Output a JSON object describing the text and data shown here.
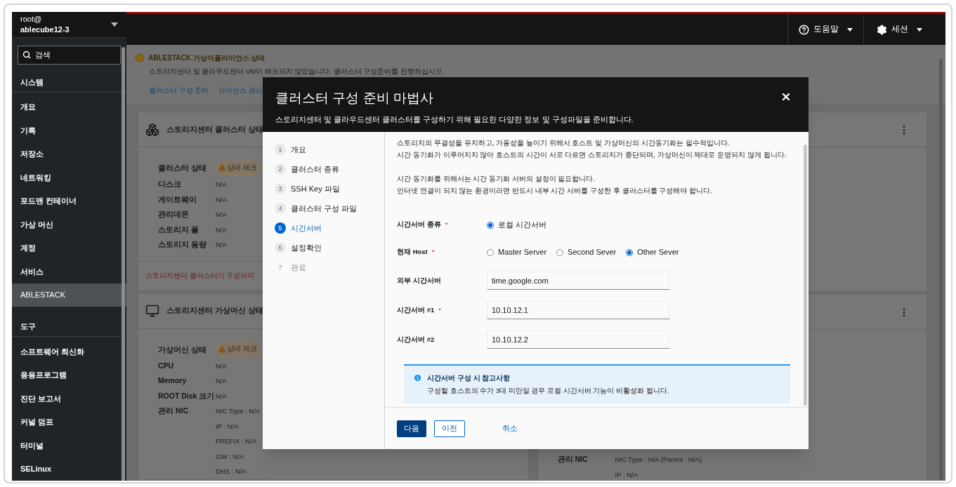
{
  "sidebar": {
    "user": "root@",
    "host": "ablecube12-3",
    "search": {
      "placeholder": "검색"
    },
    "sections": [
      {
        "title": "시스템",
        "items": [
          {
            "label": "개요",
            "selected": false
          },
          {
            "label": "기록",
            "selected": false
          },
          {
            "label": "저장소",
            "selected": false
          },
          {
            "label": "네트워킹",
            "selected": false
          },
          {
            "label": "포드맨 컨테이너",
            "selected": false
          },
          {
            "label": "가상 머신",
            "selected": false
          },
          {
            "label": "계정",
            "selected": false
          },
          {
            "label": "서비스",
            "selected": false
          },
          {
            "label": "ABLESTACK",
            "selected": true
          }
        ]
      },
      {
        "title": "도구",
        "items": [
          {
            "label": "소프트웨어 최신화",
            "selected": false
          },
          {
            "label": "응용프로그램",
            "selected": false
          },
          {
            "label": "진단 보고서",
            "selected": false
          },
          {
            "label": "커널 덤프",
            "selected": false
          },
          {
            "label": "터미널",
            "selected": false
          },
          {
            "label": "SELinux",
            "selected": false
          }
        ]
      }
    ]
  },
  "header": {
    "help": "도움말",
    "session": "세션"
  },
  "alert": {
    "title": "ABLESTACK 가상어플라이언스 상태",
    "message": "스토리지센터 및 클라우드센터 VM이 배포되지 않았습니다. 클러스터 구성준비를 진행하십시오.",
    "links": [
      "클러스터 구성 준비",
      "라이선스 관리"
    ]
  },
  "cards_left": [
    {
      "title": "스토리지센터 클러스터 상태",
      "rows": [
        {
          "label": "클러스터 상태",
          "kind": "badge",
          "values": [
            "상태 체크"
          ]
        },
        {
          "label": "디스크",
          "kind": "text",
          "values": [
            "N/A"
          ]
        },
        {
          "label": "게이트웨이",
          "kind": "text",
          "values": [
            "N/A"
          ]
        },
        {
          "label": "관리데몬",
          "kind": "text",
          "values": [
            "N/A"
          ]
        },
        {
          "label": "스토리지 풀",
          "kind": "text",
          "values": [
            "N/A"
          ]
        },
        {
          "label": "스토리지 용량",
          "kind": "text",
          "values": [
            "N/A"
          ]
        }
      ],
      "footer": "스토리지센터 클러스터가 구성되지"
    },
    {
      "title": "스토리지센터 가상머신 상태",
      "rows": [
        {
          "label": "가상머신 상태",
          "kind": "badge",
          "values": [
            "상태 체크"
          ]
        },
        {
          "label": "CPU",
          "kind": "text",
          "values": [
            "N/A"
          ]
        },
        {
          "label": "Memory",
          "kind": "text",
          "values": [
            "N/A"
          ]
        },
        {
          "label": "ROOT Disk 크기",
          "kind": "text",
          "values": [
            "N/A"
          ]
        },
        {
          "label": "관리 NIC",
          "kind": "text",
          "values": [
            "NIC Type : N/A",
            "IP : N/A",
            "PREFIX : N/A",
            "GW : N/A",
            "DNS : N/A"
          ]
        }
      ]
    }
  ],
  "right_card": {
    "rows": [
      {
        "label": "관리 NIC",
        "kind": "text",
        "values": [
          "NIC Type : N/A (Parent : N/A)",
          "IP : N/A"
        ]
      }
    ]
  },
  "modal": {
    "title": "클러스터 구성 준비 마법사",
    "subtitle": "스토리지센터 및 클라우드센터 클러스터를 구성하기 위해 필요한 다양한 정보 및 구성파일을 준비합니다.",
    "steps": [
      {
        "number": "1",
        "label": "개요",
        "selected": false,
        "disabled": false
      },
      {
        "number": "2",
        "label": "클러스터 종류",
        "selected": false,
        "disabled": false
      },
      {
        "number": "3",
        "label": "SSH Key 파일",
        "selected": false,
        "disabled": false
      },
      {
        "number": "4",
        "label": "클러스터 구성 파일",
        "selected": false,
        "disabled": false
      },
      {
        "number": "5",
        "label": "시간서버",
        "selected": true,
        "disabled": false
      },
      {
        "number": "6",
        "label": "설정확인",
        "selected": false,
        "disabled": false
      },
      {
        "number": "7",
        "label": "완료",
        "selected": false,
        "disabled": true
      }
    ],
    "intro": [
      [
        "스토리지의 무결성을 유지하고, 가용성을 높이기 위해서 호스트 및 가상머신의 시간동기화는 필수적입니다.",
        "시간 동기화가 이루어지지 않아 호스트의 시간이 서로 다르면 스토리지가 중단되며, 가상머신이 제대로 운영되지 않게 됩니다."
      ],
      [
        "시간 동기화를 위해서는 시간 동기화 서버의 설정이 필요합니다.",
        "인터넷 연결이 되지 않는 환경이라면 반드시 내부 시간 서버를 구성한 후 클러스터를 구성해야 합니다."
      ]
    ],
    "form": [
      {
        "label": "시간서버 종류",
        "required_mark": "*",
        "kind": "radio",
        "options": [
          {
            "label": "로컬 시간서버",
            "selected": true
          }
        ]
      },
      {
        "label": "현재 Host",
        "required_mark": "*",
        "kind": "radio",
        "options": [
          {
            "label": "Master Server",
            "selected": false
          },
          {
            "label": "Second Sever",
            "selected": false
          },
          {
            "label": "Other Sever",
            "selected": true
          }
        ]
      },
      {
        "label": "외부 시간서버",
        "kind": "text",
        "value": "time.google.com"
      },
      {
        "label": "시간서버 #1",
        "required_mark": "*",
        "kind": "text",
        "value": "10.10.12.1"
      },
      {
        "label": "시간서버 #2",
        "kind": "text",
        "value": "10.10.12.2"
      }
    ],
    "note": {
      "title": "시간서버 구성 시 참고사항",
      "message": "구성할 호스트의 수가 3대 미만일 경우 로컬 시간서버 기능이 비활성화 됩니다."
    },
    "buttons": [
      {
        "label": "다음",
        "kind": "primary"
      },
      {
        "label": "이전",
        "kind": "secondary"
      },
      {
        "label": "취소",
        "kind": "link"
      }
    ]
  }
}
